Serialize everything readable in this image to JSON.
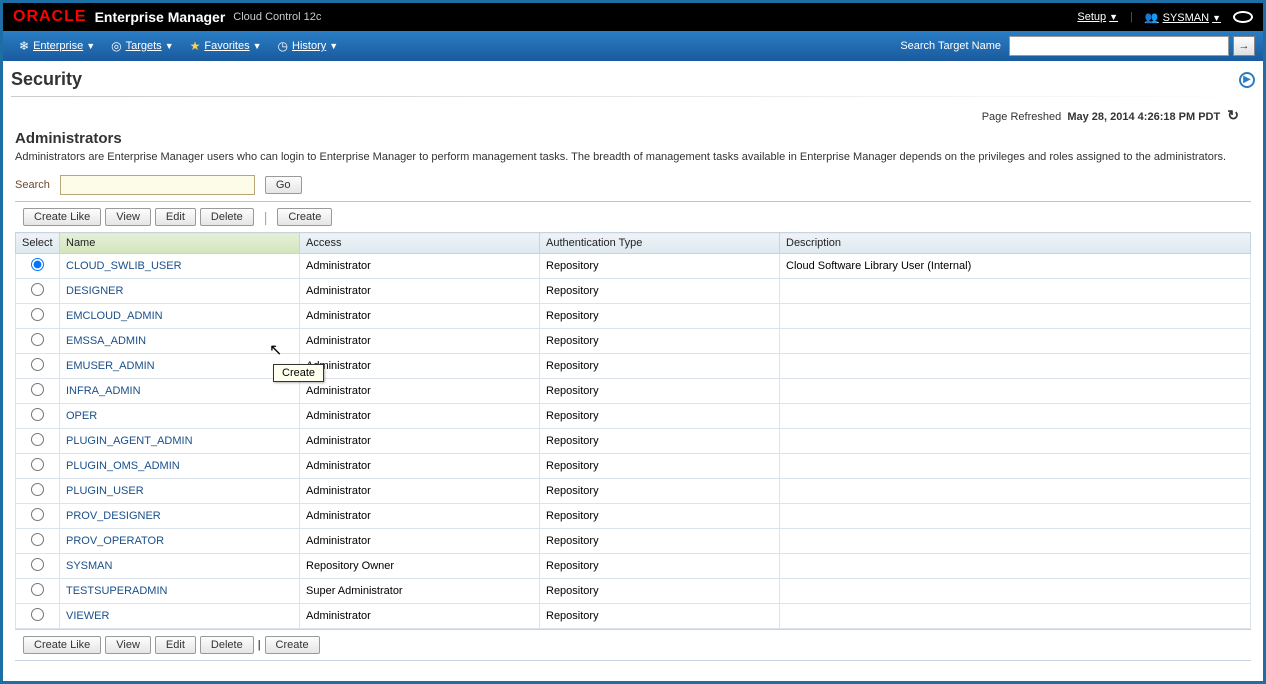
{
  "branding": {
    "logo": "ORACLE",
    "app": "Enterprise Manager",
    "suffix": "Cloud Control 12c"
  },
  "top_menu": {
    "setup": "Setup",
    "user": "SYSMAN"
  },
  "nav": {
    "enterprise": "Enterprise",
    "targets": "Targets",
    "favorites": "Favorites",
    "history": "History",
    "search_label": "Search Target Name",
    "search_value": ""
  },
  "page": {
    "title": "Security",
    "refreshed_label": "Page Refreshed",
    "refreshed_time": "May 28, 2014 4:26:18 PM PDT"
  },
  "section": {
    "title": "Administrators",
    "desc": "Administrators are Enterprise Manager users who can login to Enterprise Manager to perform management tasks. The breadth of management tasks available in Enterprise Manager depends on the privileges and roles assigned to the administrators."
  },
  "search": {
    "label": "Search",
    "value": "",
    "go": "Go"
  },
  "buttons": {
    "create_like": "Create Like",
    "view": "View",
    "edit": "Edit",
    "delete": "Delete",
    "create": "Create"
  },
  "tooltip": "Create",
  "columns": {
    "select": "Select",
    "name": "Name",
    "access": "Access",
    "auth": "Authentication Type",
    "desc": "Description"
  },
  "rows": [
    {
      "selected": true,
      "name": "CLOUD_SWLIB_USER",
      "access": "Administrator",
      "auth": "Repository",
      "desc": "Cloud Software Library User (Internal)"
    },
    {
      "selected": false,
      "name": "DESIGNER",
      "access": "Administrator",
      "auth": "Repository",
      "desc": ""
    },
    {
      "selected": false,
      "name": "EMCLOUD_ADMIN",
      "access": "Administrator",
      "auth": "Repository",
      "desc": ""
    },
    {
      "selected": false,
      "name": "EMSSA_ADMIN",
      "access": "Administrator",
      "auth": "Repository",
      "desc": ""
    },
    {
      "selected": false,
      "name": "EMUSER_ADMIN",
      "access": "Administrator",
      "auth": "Repository",
      "desc": ""
    },
    {
      "selected": false,
      "name": "INFRA_ADMIN",
      "access": "Administrator",
      "auth": "Repository",
      "desc": ""
    },
    {
      "selected": false,
      "name": "OPER",
      "access": "Administrator",
      "auth": "Repository",
      "desc": ""
    },
    {
      "selected": false,
      "name": "PLUGIN_AGENT_ADMIN",
      "access": "Administrator",
      "auth": "Repository",
      "desc": ""
    },
    {
      "selected": false,
      "name": "PLUGIN_OMS_ADMIN",
      "access": "Administrator",
      "auth": "Repository",
      "desc": ""
    },
    {
      "selected": false,
      "name": "PLUGIN_USER",
      "access": "Administrator",
      "auth": "Repository",
      "desc": ""
    },
    {
      "selected": false,
      "name": "PROV_DESIGNER",
      "access": "Administrator",
      "auth": "Repository",
      "desc": ""
    },
    {
      "selected": false,
      "name": "PROV_OPERATOR",
      "access": "Administrator",
      "auth": "Repository",
      "desc": ""
    },
    {
      "selected": false,
      "name": "SYSMAN",
      "access": "Repository Owner",
      "auth": "Repository",
      "desc": ""
    },
    {
      "selected": false,
      "name": "TESTSUPERADMIN",
      "access": "Super Administrator",
      "auth": "Repository",
      "desc": ""
    },
    {
      "selected": false,
      "name": "VIEWER",
      "access": "Administrator",
      "auth": "Repository",
      "desc": ""
    }
  ]
}
